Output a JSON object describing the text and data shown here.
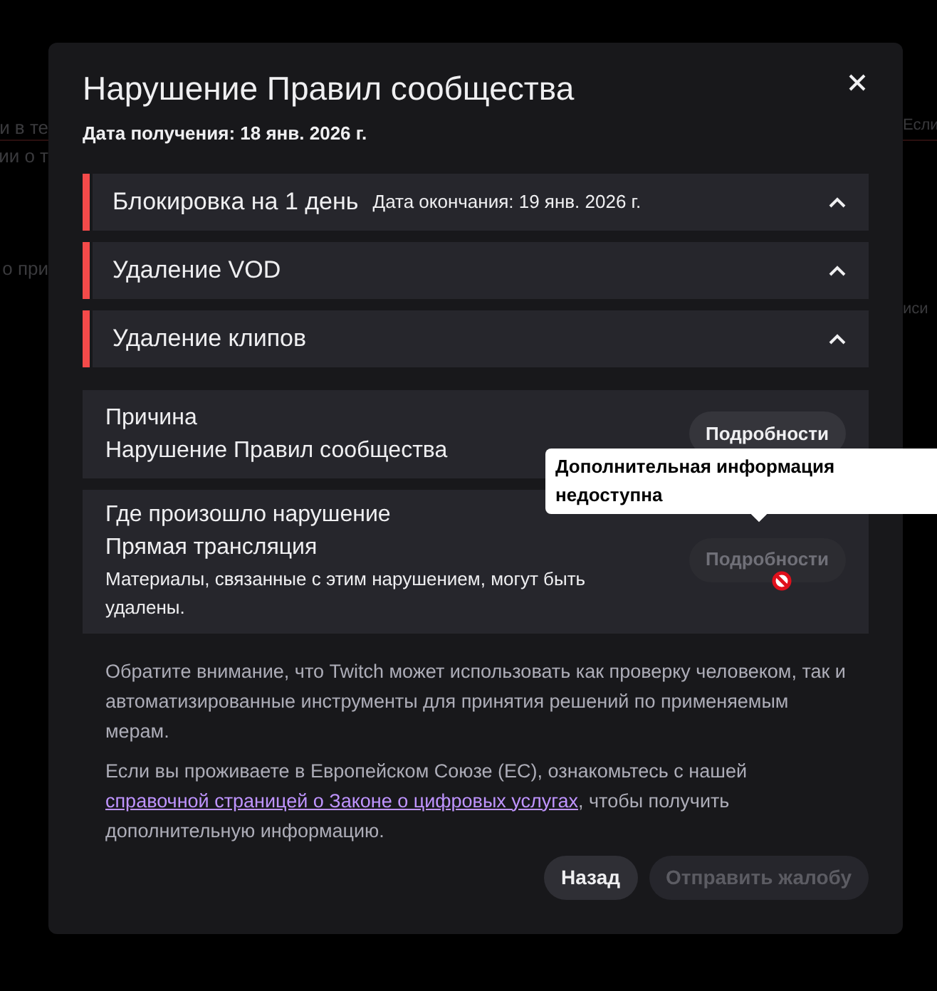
{
  "background_fragments": {
    "left": [
      "и в те",
      "ии о т",
      "о при"
    ],
    "right": [
      "Если",
      "иси"
    ]
  },
  "dialog": {
    "title": "Нарушение Правил сообщества",
    "received": "Дата получения: 18 янв. 2026 г.",
    "penalties": [
      {
        "title": "Блокировка на 1 день",
        "detail": "Дата окончания: 19 янв. 2026 г.",
        "expanded": true
      },
      {
        "title": "Удаление VOD",
        "expanded": true
      },
      {
        "title": "Удаление клипов",
        "expanded": true
      }
    ],
    "sections": [
      {
        "heading": "Причина",
        "value": "Нарушение Правил сообщества",
        "button": {
          "label": "Подробности",
          "disabled": false
        }
      },
      {
        "heading": "Где произошло нарушение",
        "value": "Прямая трансляция",
        "note": "Материалы, связанные с этим нарушением, могут быть удалены.",
        "button": {
          "label": "Подробности",
          "disabled": true
        }
      }
    ],
    "tooltip": "Дополнительная информация недоступна",
    "notice": "Обратите внимание, что Twitch может использовать как проверку человеком, так и автоматизированные инструменты для принятия решений по применяемым мерам.",
    "eu_notice": {
      "before": "Если вы проживаете в Европейском Союзе (ЕС), ознакомьтесь с нашей ",
      "link": "справочной страницей о Законе о цифровых услугах",
      "after": ", чтобы получить дополнительную информацию."
    },
    "buttons": [
      {
        "label": "Назад",
        "disabled": false
      },
      {
        "label": "Отправить жалобу",
        "disabled": true
      }
    ]
  }
}
